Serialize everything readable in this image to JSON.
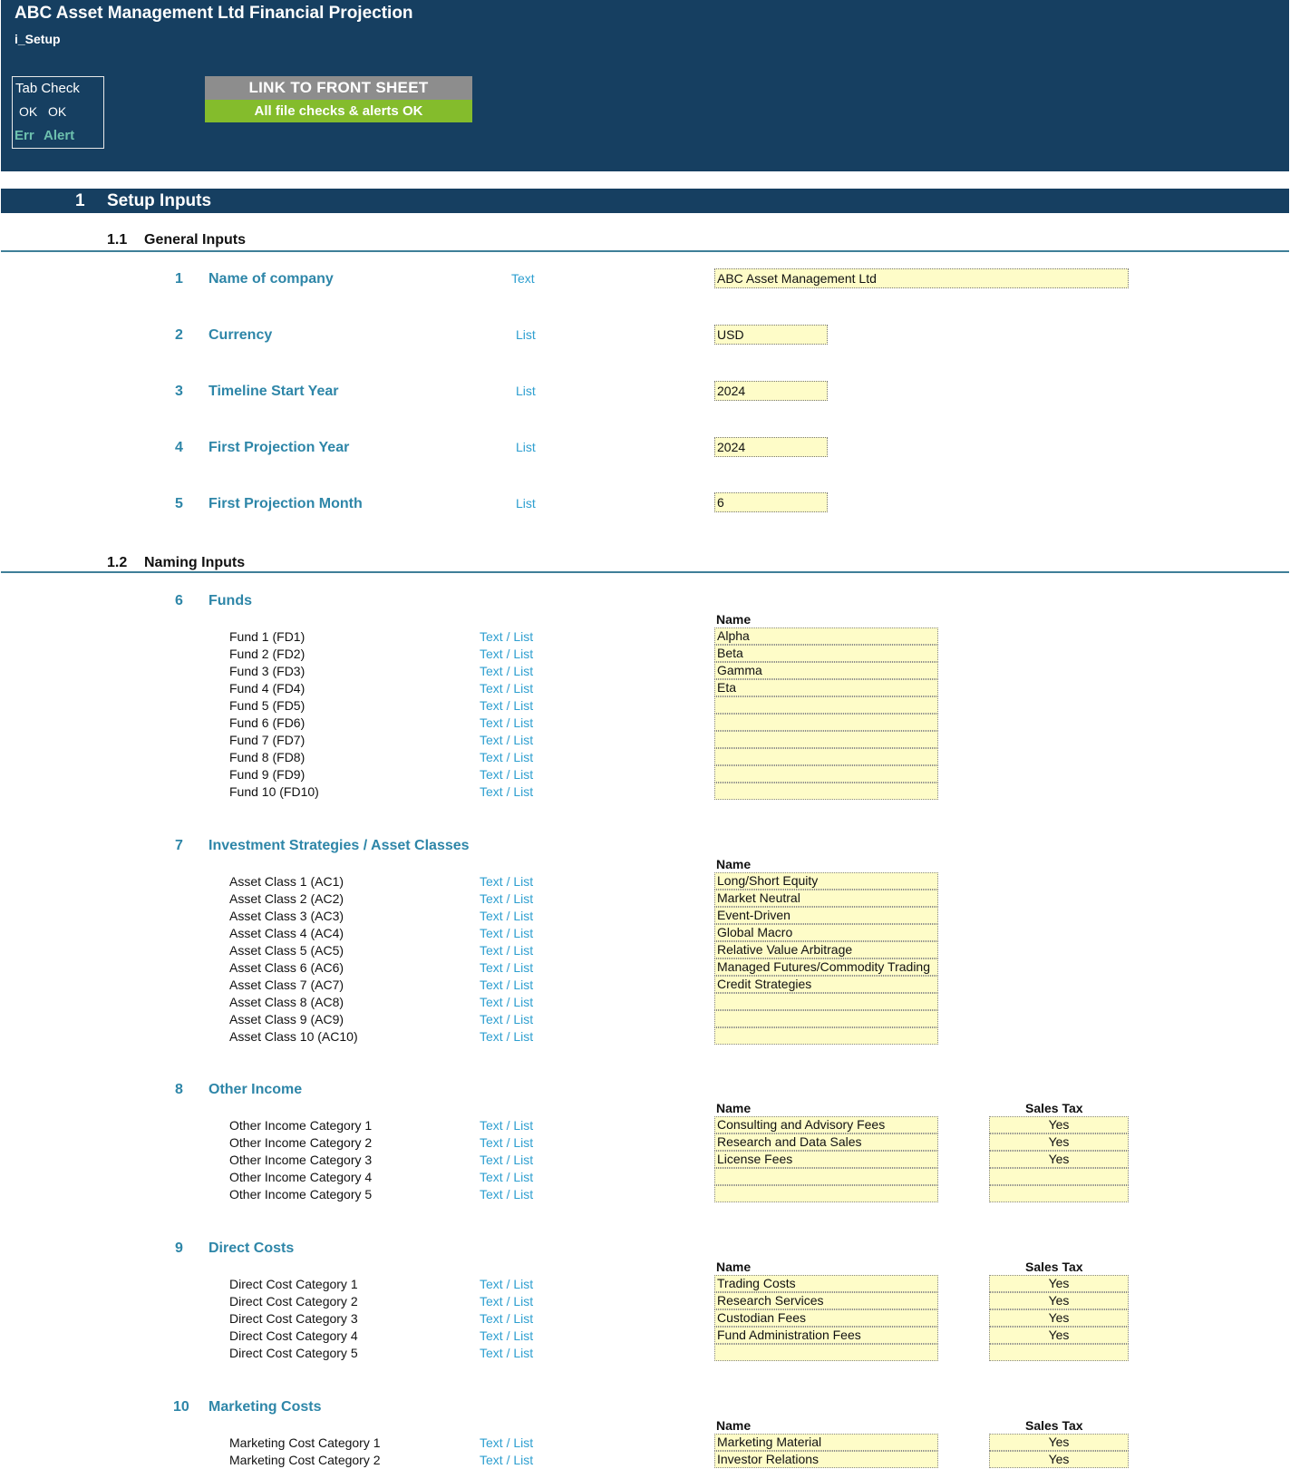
{
  "header": {
    "title": "ABC Asset Management Ltd Financial Projection",
    "sheet_name": "i_Setup",
    "tab_check": {
      "title": "Tab Check",
      "ok1": "OK",
      "ok2": "OK",
      "err": "Err",
      "alert": "Alert"
    },
    "link_button": "LINK TO FRONT SHEET",
    "check_status": "All file checks & alerts OK"
  },
  "section": {
    "number": "1",
    "title": "Setup Inputs"
  },
  "general": {
    "number": "1.1",
    "title": "General Inputs",
    "items": [
      {
        "num": "1",
        "label": "Name of company",
        "type": "Text",
        "value": "ABC Asset Management Ltd"
      },
      {
        "num": "2",
        "label": "Currency",
        "type": "List",
        "value": "USD"
      },
      {
        "num": "3",
        "label": "Timeline Start Year",
        "type": "List",
        "value": "2024"
      },
      {
        "num": "4",
        "label": "First Projection Year",
        "type": "List",
        "value": "2024"
      },
      {
        "num": "5",
        "label": "First Projection Month",
        "type": "List",
        "value": "6"
      }
    ]
  },
  "naming": {
    "number": "1.2",
    "title": "Naming Inputs",
    "col_name": "Name",
    "col_tax": "Sales Tax",
    "row_type": "Text / List",
    "groups": [
      {
        "num": "6",
        "title": "Funds",
        "rows": [
          {
            "label": "Fund 1 (FD1)",
            "name": "Alpha"
          },
          {
            "label": "Fund 2 (FD2)",
            "name": "Beta"
          },
          {
            "label": "Fund 3 (FD3)",
            "name": "Gamma"
          },
          {
            "label": "Fund 4 (FD4)",
            "name": "Eta"
          },
          {
            "label": "Fund 5 (FD5)",
            "name": ""
          },
          {
            "label": "Fund 6 (FD6)",
            "name": ""
          },
          {
            "label": "Fund 7 (FD7)",
            "name": ""
          },
          {
            "label": "Fund 8 (FD8)",
            "name": ""
          },
          {
            "label": "Fund 9 (FD9)",
            "name": ""
          },
          {
            "label": "Fund 10 (FD10)",
            "name": ""
          }
        ]
      },
      {
        "num": "7",
        "title": "Investment Strategies / Asset Classes",
        "rows": [
          {
            "label": "Asset Class 1 (AC1)",
            "name": "Long/Short Equity"
          },
          {
            "label": "Asset Class 2 (AC2)",
            "name": "Market Neutral"
          },
          {
            "label": "Asset Class 3 (AC3)",
            "name": "Event-Driven"
          },
          {
            "label": "Asset Class 4 (AC4)",
            "name": "Global Macro"
          },
          {
            "label": "Asset Class 5 (AC5)",
            "name": "Relative Value Arbitrage"
          },
          {
            "label": "Asset Class 6 (AC6)",
            "name": "Managed Futures/Commodity Trading"
          },
          {
            "label": "Asset Class 7 (AC7)",
            "name": "Credit Strategies"
          },
          {
            "label": "Asset Class 8 (AC8)",
            "name": ""
          },
          {
            "label": "Asset Class 9 (AC9)",
            "name": ""
          },
          {
            "label": "Asset Class 10 (AC10)",
            "name": ""
          }
        ]
      },
      {
        "num": "8",
        "title": "Other Income",
        "rows": [
          {
            "label": "Other Income Category 1",
            "name": "Consulting and Advisory Fees",
            "tax": "Yes"
          },
          {
            "label": "Other Income Category 2",
            "name": "Research and Data Sales",
            "tax": "Yes"
          },
          {
            "label": "Other Income Category 3",
            "name": "License Fees",
            "tax": "Yes"
          },
          {
            "label": "Other Income Category 4",
            "name": "",
            "tax": ""
          },
          {
            "label": "Other Income Category 5",
            "name": "",
            "tax": ""
          }
        ]
      },
      {
        "num": "9",
        "title": "Direct Costs",
        "rows": [
          {
            "label": "Direct Cost Category 1",
            "name": "Trading Costs",
            "tax": "Yes"
          },
          {
            "label": "Direct Cost Category 2",
            "name": "Research Services",
            "tax": "Yes"
          },
          {
            "label": "Direct Cost Category 3",
            "name": "Custodian Fees",
            "tax": "Yes"
          },
          {
            "label": "Direct Cost Category 4",
            "name": "Fund Administration Fees",
            "tax": "Yes"
          },
          {
            "label": "Direct Cost Category 5",
            "name": "",
            "tax": ""
          }
        ]
      },
      {
        "num": "10",
        "title": "Marketing Costs",
        "rows": [
          {
            "label": "Marketing Cost Category 1",
            "name": "Marketing Material",
            "tax": "Yes"
          },
          {
            "label": "Marketing Cost Category 2",
            "name": "Investor Relations",
            "tax": "Yes"
          }
        ]
      }
    ]
  }
}
